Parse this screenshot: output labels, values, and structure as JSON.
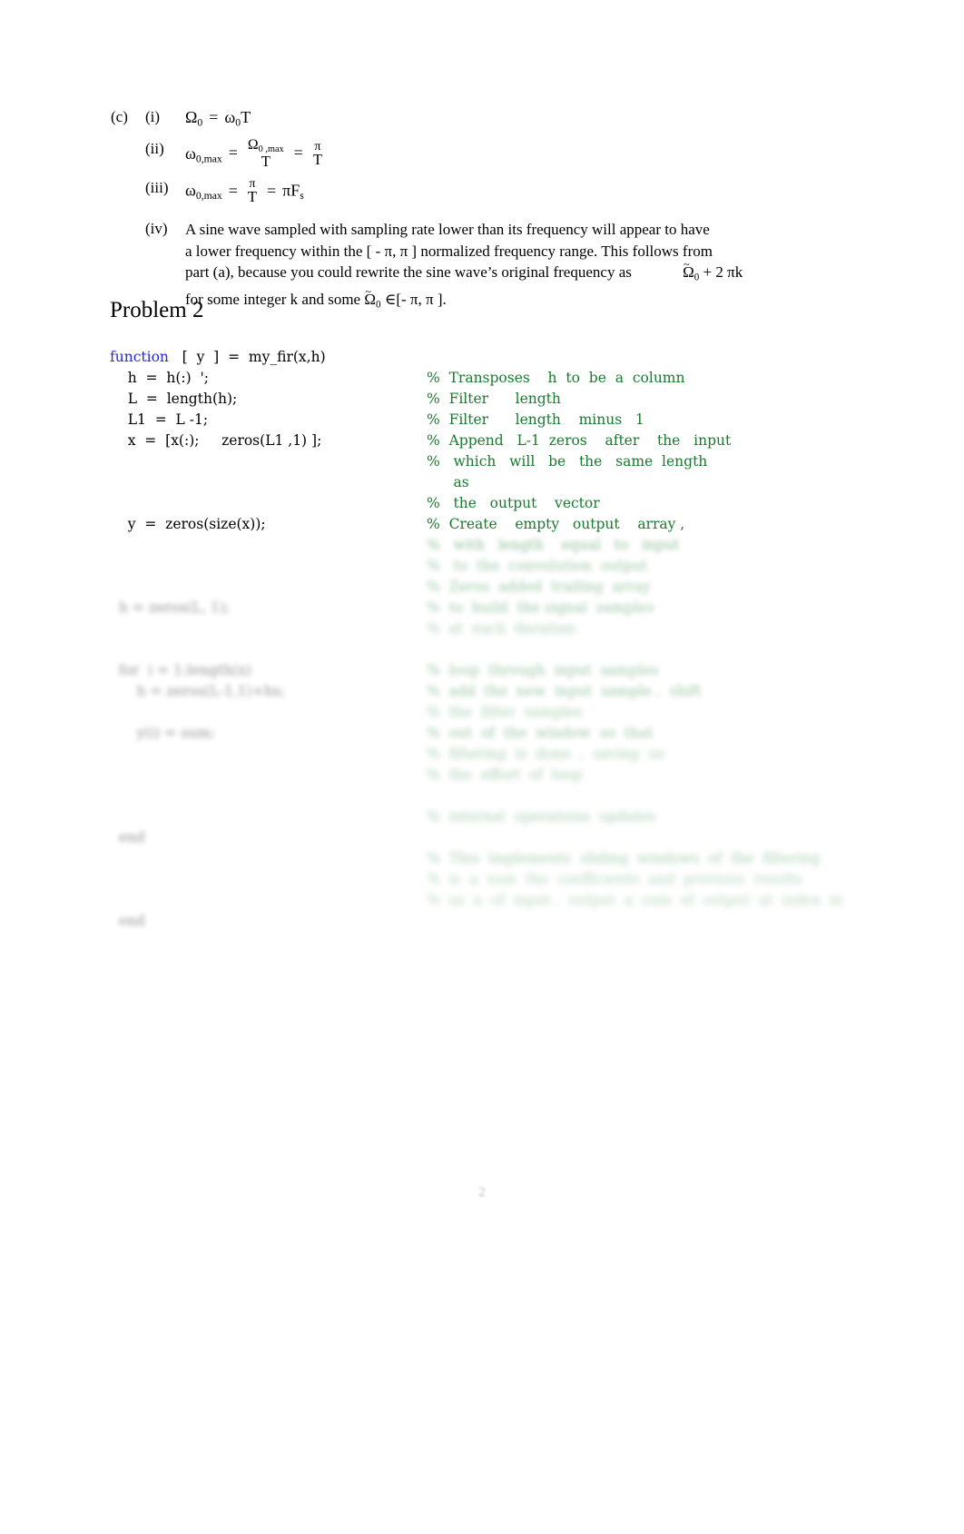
{
  "part_c": {
    "label": "(c)",
    "items": [
      {
        "roman": "(i)",
        "lhs": "Ω",
        "lhs_sub": "0",
        "eq": "=",
        "rhs_a": "ω",
        "rhs_sub": "0",
        "rhs_b": "T",
        "plain": "Ω₀ = ω₀T"
      },
      {
        "roman": "(ii)",
        "lhs": "ω",
        "lhs_sub": "0,max",
        "eq1": "=",
        "frac1_num": "Ω",
        "frac1_num_sub": "0 ,max",
        "frac1_den": "T",
        "eq2": "=",
        "frac2_num": "π",
        "frac2_den": "T",
        "plain": "ω₀,ₘₐₓ = Ω₀,max / T = π / T"
      },
      {
        "roman": "(iii)",
        "lhs": "ω",
        "lhs_sub": "0,max",
        "eq1": "=",
        "frac_num": "π",
        "frac_den": "T",
        "eq2": "=",
        "rhs": "πF",
        "rhs_sub": "s",
        "plain": "ω₀,max = π / T = πFₛ"
      },
      {
        "roman": "(iv)",
        "line1": "A sine wave sampled with sampling rate lower than its frequency will appear to have",
        "line2_a": "a lower frequency within the [  - π, π ] normalized frequency range. This follows from",
        "line3_a": "part (a), because you could rewrite the sine wave’s original frequency as",
        "line3_math_om": "Ω",
        "line3_math_sub": "0",
        "line3_math_tail": " + 2 πk",
        "line4_a": "for some integer  k and some  ",
        "line4_math_om": "Ω",
        "line4_math_sub": "0",
        "line4_tail": " ∈[- π, π ]."
      }
    ]
  },
  "problem2": {
    "heading": "Problem 2"
  },
  "code": {
    "language": "matlab",
    "keyword_color": "#2727d6",
    "comment_color": "#1a7a2e",
    "lines": [
      {
        "code": "function   [  y  ]  =  my_fir(x,h)",
        "keyword": "function",
        "code_rest": "   [  y  ]  =  my_fir(x,h)",
        "comment": "",
        "blur": 0
      },
      {
        "code": "    h  =  h(:)  ';",
        "comment": "%  Transposes    h  to  be  a  column",
        "blur": 0
      },
      {
        "code": "    L  =  length(h);",
        "comment": "%  Filter      length",
        "blur": 0
      },
      {
        "code": "    L1  =  L -1;",
        "comment": "%  Filter      length    minus   1",
        "blur": 0
      },
      {
        "code": "    x  =  [x(:);     zeros(L1 ,1) ];",
        "comment": "%  Append   L-1  zeros    after    the   input",
        "blur": 0
      },
      {
        "code": "",
        "comment": "%   which   will   be   the   same  length",
        "blur": 0
      },
      {
        "code": "",
        "comment": "      as",
        "blur": 0
      },
      {
        "code": "",
        "comment": "%   the   output    vector",
        "blur": 0
      },
      {
        "code": "    y  =  zeros(size(x));",
        "comment": "%  Create    empty   output    array ,",
        "blur": 0
      },
      {
        "code": "",
        "comment": "%   with   length    equal   to   input",
        "blur": 1
      },
      {
        "code": "",
        "comment": "%   to  the  convolution  output",
        "blur": 2
      },
      {
        "code": "",
        "comment": "%  Zeros  added  trailing  array",
        "blur": 2
      },
      {
        "code": "  h = zeros(L, 1);",
        "comment": "%  to  build  the signal  samples",
        "blur": 2
      },
      {
        "code": "",
        "comment": "%  at  each  iteration",
        "blur": 3
      },
      {
        "code": "",
        "comment": "",
        "blur": 3
      },
      {
        "code": "  for  i = 1:length(x)",
        "comment": "%  loop  through  input  samples",
        "blur": 2
      },
      {
        "code": "      h = zeros(L-1,1)+hs;",
        "comment": "%  add  the  new  input  sample ,  shift",
        "blur": 2
      },
      {
        "code": "",
        "comment": "%  the  filter  samples",
        "blur": 3
      },
      {
        "code": "      y(i) = sum;",
        "comment": "%  out  of  the  window  so  that",
        "blur": 2
      },
      {
        "code": "",
        "comment": "%  filtering  is  done  ,  saving  us",
        "blur": 3
      },
      {
        "code": "",
        "comment": "%  the  effort  of  loop",
        "blur": 3
      },
      {
        "code": "",
        "comment": "",
        "blur": 4
      },
      {
        "code": "",
        "comment": "%  internal  operations  updates",
        "blur": 3
      },
      {
        "code": "  end",
        "comment": "",
        "blur": 2
      },
      {
        "code": "",
        "comment": "%  This  implements  sliding  windows  of  the  filtering",
        "blur": 3
      },
      {
        "code": "",
        "comment": "%  is  a  sum  the  coefficients  and  previous  results",
        "blur": 4
      },
      {
        "code": "",
        "comment": "%  as  a  of  input ,  output  a  sum  of  output  at  index  in",
        "blur": 4
      },
      {
        "code": "  end",
        "comment": "",
        "blur": 2
      }
    ]
  },
  "page_number": "2"
}
